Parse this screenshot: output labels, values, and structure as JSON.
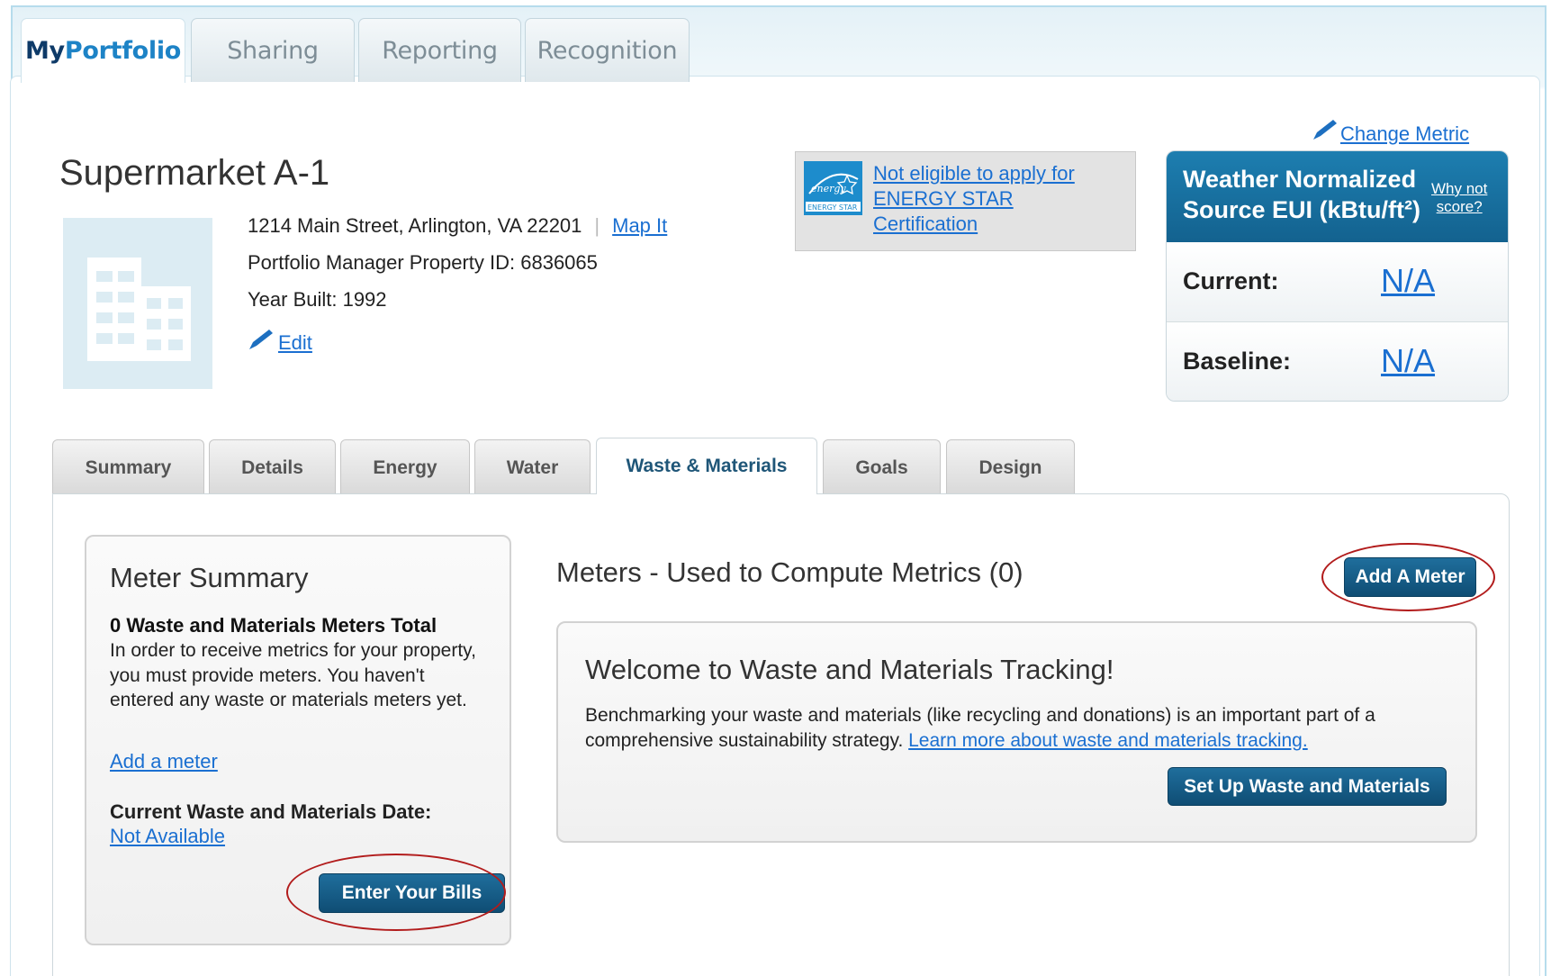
{
  "top_tabs": {
    "myportfolio_my": "My",
    "myportfolio_portfolio": "Portfolio",
    "sharing": "Sharing",
    "reporting": "Reporting",
    "recognition": "Recognition"
  },
  "property": {
    "name": "Supermarket A-1",
    "address": "1214 Main Street, Arlington, VA 22201",
    "map_link": "Map It",
    "property_id_line": "Portfolio Manager Property ID: 6836065",
    "year_built_line": "Year Built: 1992",
    "edit_link": "Edit"
  },
  "energy_star": {
    "line1": "Not eligible to apply for",
    "line2": "ENERGY STAR",
    "line3": "Certification",
    "logo_text": "ENERGY STAR"
  },
  "metric": {
    "change_link": "Change Metric",
    "title_line1": "Weather Normalized",
    "title_line2": "Source EUI (kBtu/ft²)",
    "why_line1": "Why not",
    "why_line2": "score?",
    "current_label": "Current:",
    "current_value": "N/A",
    "baseline_label": "Baseline:",
    "baseline_value": "N/A"
  },
  "sub_tabs": {
    "summary": "Summary",
    "details": "Details",
    "energy": "Energy",
    "water": "Water",
    "waste": "Waste & Materials",
    "goals": "Goals",
    "design": "Design"
  },
  "meter_summary": {
    "title": "Meter Summary",
    "total": "0 Waste and Materials Meters Total",
    "description": "In order to receive metrics for your property, you must provide meters. You haven't entered any waste or materials meters yet.",
    "add_link": "Add a meter",
    "date_label": "Current Waste and Materials Date:",
    "date_value": "Not Available",
    "enter_bills": "Enter Your Bills"
  },
  "meters": {
    "title": "Meters - Used to Compute Metrics (0)",
    "add_button": "Add A Meter"
  },
  "welcome": {
    "title": "Welcome to Waste and Materials Tracking!",
    "text": "Benchmarking your waste and materials (like recycling and donations) is an important part of a comprehensive sustainability strategy.",
    "learn_link": "Learn more about waste and materials tracking.",
    "setup_button": "Set Up Waste and Materials"
  },
  "colors": {
    "brand_dark_blue": "#0e3a68",
    "link_blue": "#1a6fd1",
    "button_blue": "#145a85",
    "highlight_ring": "#b21c1c"
  }
}
